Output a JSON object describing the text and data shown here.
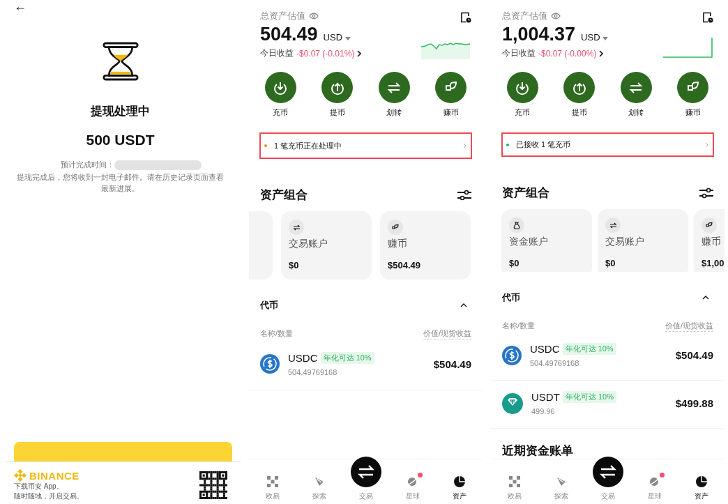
{
  "withdrawal": {
    "back": "←",
    "title": "提现处理中",
    "amount": "500 USDT",
    "eta_label": "预计完成时间：",
    "message": "提现完成后，您将收到一封电子邮件。请在历史记录页面查看最新进展。",
    "footer": {
      "brand": "BINANCE",
      "lines": [
        "下载币安 App。",
        "随时随地，开启交易。"
      ]
    }
  },
  "wallets": [
    {
      "total_label": "总资产估值",
      "balance": "504.49",
      "currency": "USD",
      "pnl_label": "今日收益",
      "pnl": "-$0.07 (-0.01%)",
      "trend": {
        "kind": "wavy"
      },
      "actions": [
        {
          "kind": "deposit",
          "label": "充币"
        },
        {
          "kind": "withdraw",
          "label": "提币"
        },
        {
          "kind": "transfer",
          "label": "划转"
        },
        {
          "kind": "earn",
          "label": "赚币"
        }
      ],
      "notice": {
        "text": "1 笔充币正在处理中",
        "color": "#f0883e"
      },
      "portfolio": {
        "title": "资产组合",
        "leading_card_cut": true,
        "accounts": [
          {
            "kind": "trade",
            "name": "交易账户",
            "value": "$0"
          },
          {
            "kind": "earn",
            "name": "赚币",
            "value": "$504.49"
          }
        ]
      },
      "tokens": {
        "title": "代币",
        "expanded": true,
        "col_name": "名称/数量",
        "col_value": "价值/现货收益",
        "rows": [
          {
            "kind": "usdc",
            "symbol": "USDC",
            "badge": "年化可达 10%",
            "amount": "504.49769168",
            "value": "$504.49"
          }
        ]
      },
      "nav": [
        {
          "kind": "home",
          "label": "欧易",
          "selected": false,
          "notification": false
        },
        {
          "kind": "explore",
          "label": "探索",
          "selected": false,
          "notification": false
        },
        {
          "kind": "trade",
          "label": "交易",
          "selected": false,
          "notification": false
        },
        {
          "kind": "planet",
          "label": "星球",
          "selected": false,
          "notification": true
        },
        {
          "kind": "assets",
          "label": "资产",
          "selected": true,
          "notification": false
        }
      ]
    },
    {
      "total_label": "总资产估值",
      "balance": "1,004.37",
      "currency": "USD",
      "pnl_label": "今日收益",
      "pnl": "-$0.07 (-0.00%)",
      "trend": {
        "kind": "step"
      },
      "actions": [
        {
          "kind": "deposit",
          "label": "充币"
        },
        {
          "kind": "withdraw",
          "label": "提币"
        },
        {
          "kind": "transfer",
          "label": "划转"
        },
        {
          "kind": "earn",
          "label": "赚币"
        }
      ],
      "notice": {
        "text": "已接收 1 笔充币",
        "color": "#20b26c"
      },
      "portfolio": {
        "title": "资产组合",
        "leading_card_cut": false,
        "accounts": [
          {
            "kind": "funding",
            "name": "资金账户",
            "value": "$0"
          },
          {
            "kind": "trade",
            "name": "交易账户",
            "value": "$0"
          },
          {
            "kind": "earn",
            "name": "赚币",
            "value": "$1,00"
          }
        ]
      },
      "tokens": {
        "title": "代币",
        "expanded": true,
        "col_name": "名称/数量",
        "col_value": "价值/现货收益",
        "rows": [
          {
            "kind": "usdc",
            "symbol": "USDC",
            "badge": "年化可达 10%",
            "amount": "504.49769168",
            "value": "$504.49"
          },
          {
            "kind": "usdt",
            "symbol": "USDT",
            "badge": "年化可达 10%",
            "amount": "499.96",
            "value": "$499.88"
          }
        ]
      },
      "recent_title": "近期资金账单",
      "nav": [
        {
          "kind": "home",
          "label": "欧易",
          "selected": false,
          "notification": false
        },
        {
          "kind": "explore",
          "label": "探索",
          "selected": false,
          "notification": false
        },
        {
          "kind": "trade",
          "label": "交易",
          "selected": false,
          "notification": false
        },
        {
          "kind": "planet",
          "label": "星球",
          "selected": false,
          "notification": true
        },
        {
          "kind": "assets",
          "label": "资产",
          "selected": true,
          "notification": false
        }
      ]
    }
  ]
}
